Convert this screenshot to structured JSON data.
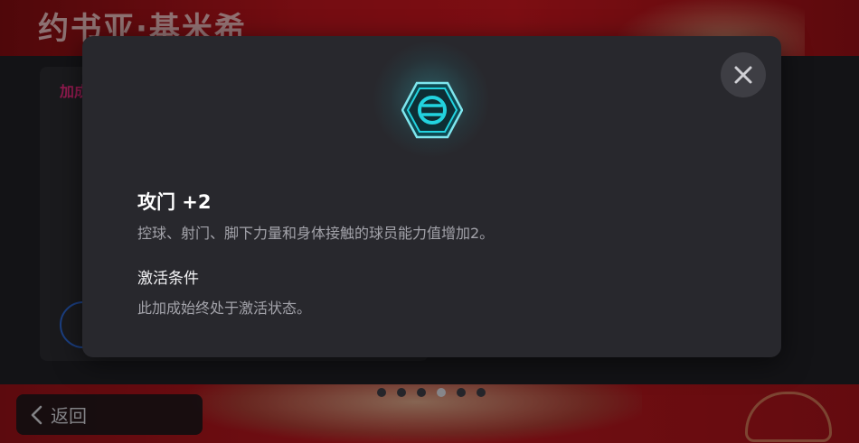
{
  "header": {
    "player_name": "约书亚·基米希"
  },
  "background_card": {
    "title": "加成"
  },
  "pagination": {
    "count": 6,
    "active_index": 3
  },
  "footer": {
    "back_label": "返回"
  },
  "modal": {
    "badge_icon": "hexagon-boost-icon",
    "close_icon": "close-icon",
    "boost_title": "攻门 +2",
    "boost_description": "控球、射门、脚下力量和身体接触的球员能力值增加2。",
    "condition_heading": "激活条件",
    "condition_text": "此加成始终处于激活状态。"
  },
  "colors": {
    "accent_cyan": "#22d3df",
    "header_red": "#b3141c",
    "card_title_pink": "#e0287a",
    "modal_bg": "#28282d"
  }
}
